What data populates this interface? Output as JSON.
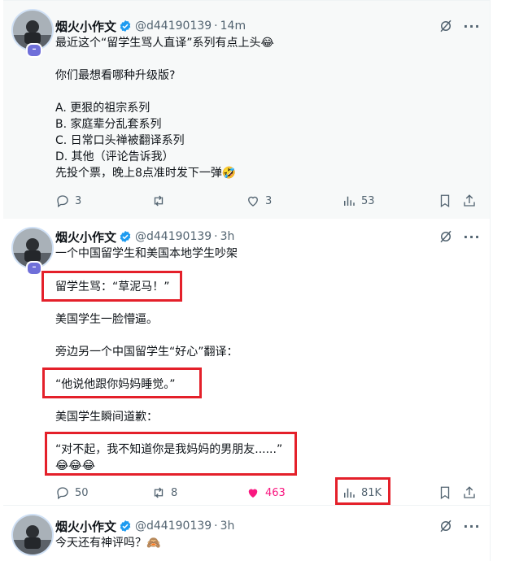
{
  "colors": {
    "accent": "#1d9bf0",
    "liked": "#f91880",
    "highlight": "#e4202a",
    "muted": "#536471"
  },
  "tweets": [
    {
      "author": {
        "name": "烟火小作文",
        "handle": "@d44190139",
        "verified": true
      },
      "time": "14m",
      "text": "最近这个“留学生骂人直译”系列有点上头😂\n\n你们最想看哪种升级版?\n\nA. 更狠的祖宗系列\nB. 家庭辈分乱套系列\nC. 日常口头禅被翻译系列\nD. 其他（评论告诉我）\n先投个票，晚上8点准时发下一弹🤣",
      "replies": "3",
      "reposts": "",
      "likes": "3",
      "views": "53"
    },
    {
      "author": {
        "name": "烟火小作文",
        "handle": "@d44190139",
        "verified": true
      },
      "time": "3h",
      "paragraphs": [
        "一个中国留学生和美国本地学生吵架",
        "留学生骂：“草泥马！”",
        "美国学生一脸懵逼。",
        "旁边另一个中国留学生“好心”翻译：",
        "“他说他跟你妈妈睡觉。”",
        "美国学生瞬间道歉：",
        "“对不起，我不知道你是我妈妈的男朋友......”\n😂😂😂"
      ],
      "replies": "50",
      "reposts": "8",
      "likes": "463",
      "views": "81K"
    },
    {
      "author": {
        "name": "烟火小作文",
        "handle": "@d44190139",
        "verified": true
      },
      "time": "3h",
      "text": "今天还有神评吗？🙈"
    }
  ],
  "icons": {
    "grok": "grok-icon",
    "more": "more-icon",
    "reply": "reply-icon",
    "repost": "repost-icon",
    "like": "like-icon",
    "views": "views-icon",
    "bookmark": "bookmark-icon",
    "share": "share-icon"
  }
}
